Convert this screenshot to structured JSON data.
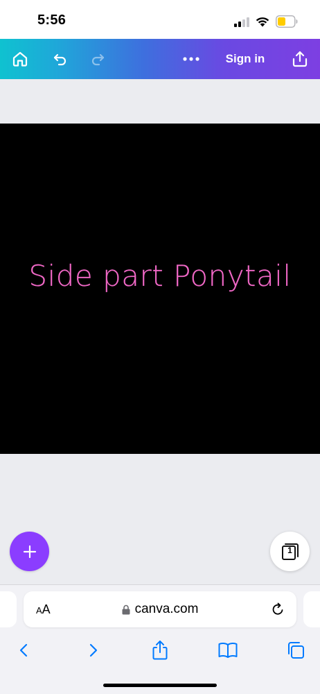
{
  "status_bar": {
    "time": "5:56",
    "signal_icon": "cellular-signal-icon",
    "wifi_icon": "wifi-icon",
    "battery_icon": "battery-low-icon",
    "battery_color": "#ffcc00"
  },
  "toolbar": {
    "home_icon": "home-icon",
    "undo_icon": "undo-icon",
    "redo_icon": "redo-icon",
    "more_icon": "more-horizontal-icon",
    "signin_label": "Sign in",
    "share_icon": "share-icon",
    "gradient": [
      "#0fc2d0",
      "#3e6fde",
      "#7d3fe2"
    ]
  },
  "canvas": {
    "text": "Side part Ponytail",
    "text_color": "#f068c6",
    "background": "#000000"
  },
  "add_button": {
    "icon": "plus-icon",
    "color": "#8b3dff"
  },
  "pages_button": {
    "icon": "pages-icon",
    "page_count": "1"
  },
  "safari": {
    "aa_label_small": "A",
    "aa_label_large": "A",
    "url": "canva.com",
    "lock_icon": "lock-icon",
    "reload_icon": "reload-icon",
    "back_icon": "chevron-left-icon",
    "forward_icon": "chevron-right-icon",
    "share_icon": "share-icon",
    "bookmarks_icon": "book-icon",
    "tabs_icon": "tabs-icon",
    "accent": "#007aff"
  }
}
